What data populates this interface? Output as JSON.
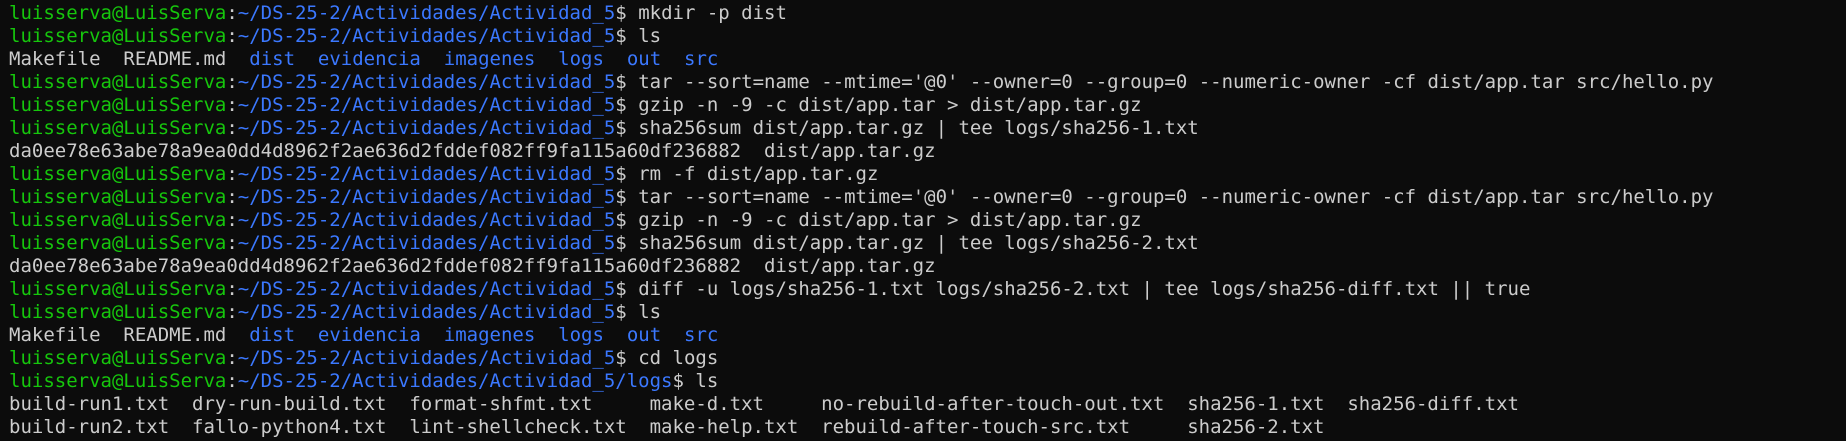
{
  "terminal": {
    "prompt_user": "luisserva@LuisServa",
    "prompt_path": "~/DS-25-2/Actividades/Actividad_5",
    "prompt_path_logs": "~/DS-25-2/Actividades/Actividad_5/logs",
    "lines": [
      {
        "type": "prompt",
        "path_key": "base",
        "command": "mkdir -p dist"
      },
      {
        "type": "prompt",
        "path_key": "base",
        "command": "ls"
      },
      {
        "type": "listing",
        "entries": [
          {
            "text": "Makefile",
            "kind": "file"
          },
          {
            "text": "README.md",
            "kind": "file"
          },
          {
            "text": "dist",
            "kind": "dir"
          },
          {
            "text": "evidencia",
            "kind": "dir"
          },
          {
            "text": "imagenes",
            "kind": "dir"
          },
          {
            "text": "logs",
            "kind": "dir"
          },
          {
            "text": "out",
            "kind": "dir"
          },
          {
            "text": "src",
            "kind": "dir"
          }
        ]
      },
      {
        "type": "prompt",
        "path_key": "base",
        "command": "tar --sort=name --mtime='@0' --owner=0 --group=0 --numeric-owner -cf dist/app.tar src/hello.py"
      },
      {
        "type": "prompt",
        "path_key": "base",
        "command": "gzip -n -9 -c dist/app.tar > dist/app.tar.gz"
      },
      {
        "type": "prompt",
        "path_key": "base",
        "command": "sha256sum dist/app.tar.gz | tee logs/sha256-1.txt"
      },
      {
        "type": "output",
        "text": "da0ee78e63abe78a9ea0dd4d8962f2ae636d2fddef082ff9fa115a60df236882  dist/app.tar.gz"
      },
      {
        "type": "prompt",
        "path_key": "base",
        "command": "rm -f dist/app.tar.gz"
      },
      {
        "type": "prompt",
        "path_key": "base",
        "command": "tar --sort=name --mtime='@0' --owner=0 --group=0 --numeric-owner -cf dist/app.tar src/hello.py"
      },
      {
        "type": "prompt",
        "path_key": "base",
        "command": "gzip -n -9 -c dist/app.tar > dist/app.tar.gz"
      },
      {
        "type": "prompt",
        "path_key": "base",
        "command": "sha256sum dist/app.tar.gz | tee logs/sha256-2.txt"
      },
      {
        "type": "output",
        "text": "da0ee78e63abe78a9ea0dd4d8962f2ae636d2fddef082ff9fa115a60df236882  dist/app.tar.gz"
      },
      {
        "type": "prompt",
        "path_key": "base",
        "command": "diff -u logs/sha256-1.txt logs/sha256-2.txt | tee logs/sha256-diff.txt || true"
      },
      {
        "type": "prompt",
        "path_key": "base",
        "command": "ls"
      },
      {
        "type": "listing",
        "entries": [
          {
            "text": "Makefile",
            "kind": "file"
          },
          {
            "text": "README.md",
            "kind": "file"
          },
          {
            "text": "dist",
            "kind": "dir"
          },
          {
            "text": "evidencia",
            "kind": "dir"
          },
          {
            "text": "imagenes",
            "kind": "dir"
          },
          {
            "text": "logs",
            "kind": "dir"
          },
          {
            "text": "out",
            "kind": "dir"
          },
          {
            "text": "src",
            "kind": "dir"
          }
        ]
      },
      {
        "type": "prompt",
        "path_key": "base",
        "command": "cd logs"
      },
      {
        "type": "prompt",
        "path_key": "logs",
        "command": "ls"
      },
      {
        "type": "output",
        "text": "build-run1.txt  dry-run-build.txt  format-shfmt.txt     make-d.txt     no-rebuild-after-touch-out.txt  sha256-1.txt  sha256-diff.txt"
      },
      {
        "type": "output",
        "text": "build-run2.txt  fallo-python4.txt  lint-shellcheck.txt  make-help.txt  rebuild-after-touch-src.txt     sha256-2.txt"
      }
    ]
  },
  "colors": {
    "background": "#0c0c0c",
    "foreground": "#cccccc",
    "prompt_user": "#16c60c",
    "prompt_path": "#3b78ff",
    "directory": "#3b78ff"
  }
}
